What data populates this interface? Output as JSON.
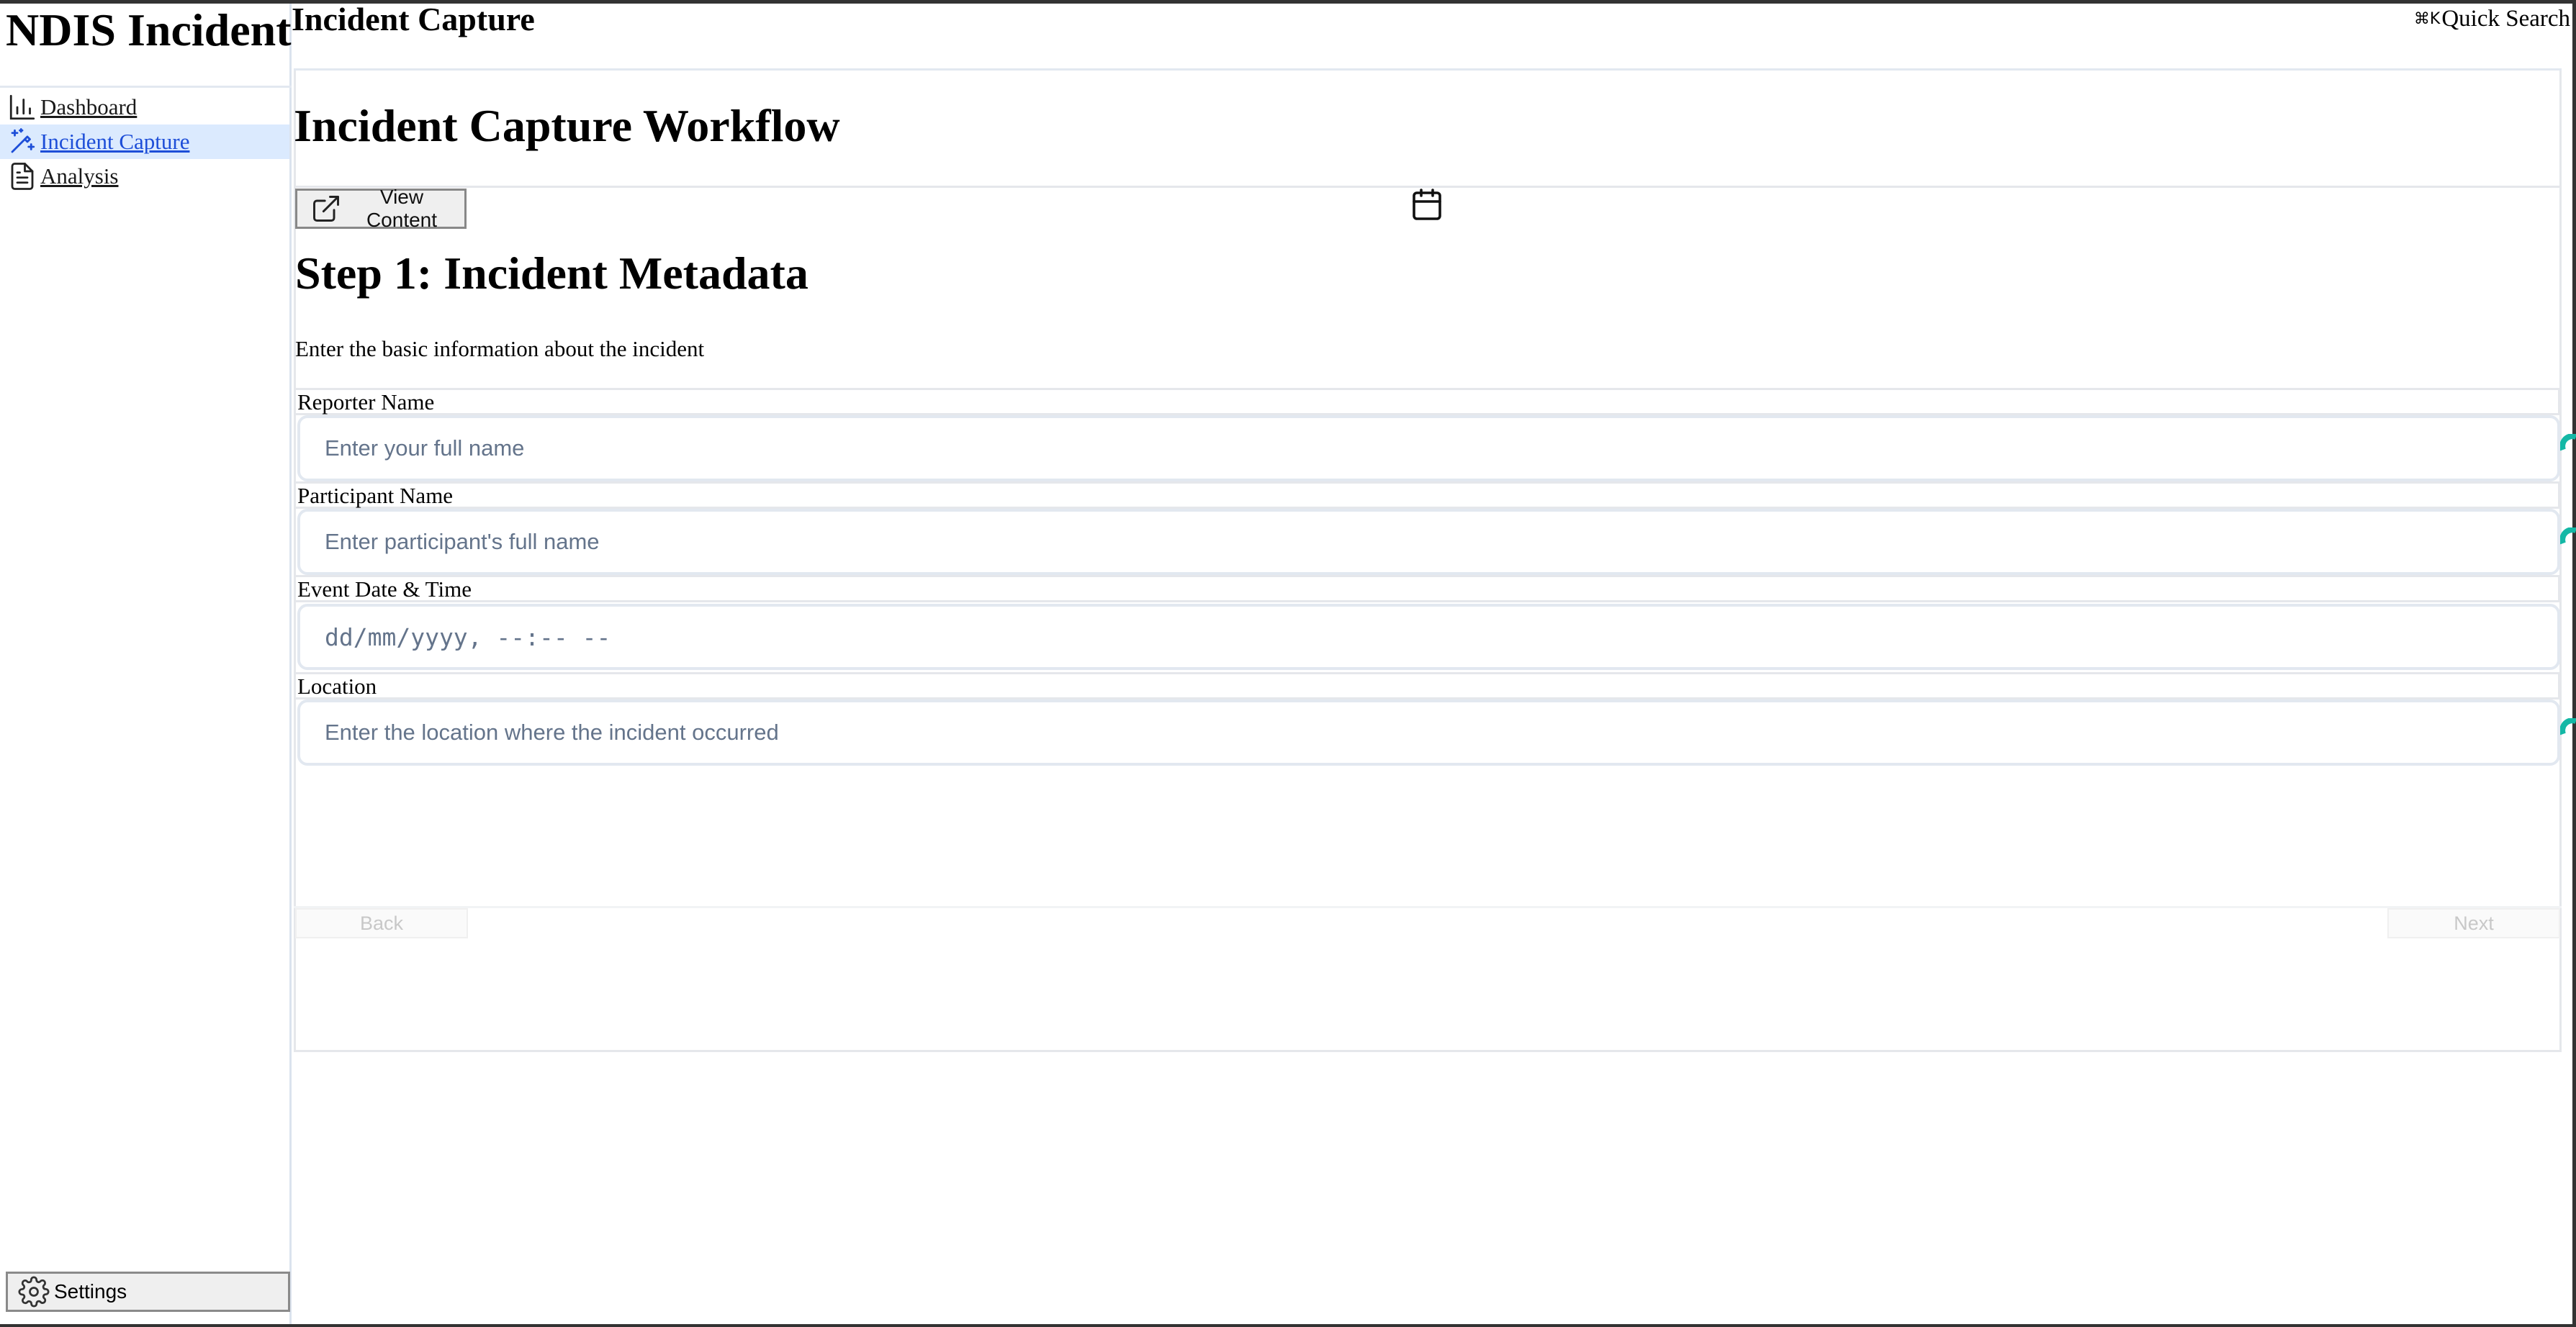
{
  "sidebar": {
    "brand": "NDIS Incident",
    "items": [
      {
        "label": "Dashboard",
        "icon": "bar-chart-icon"
      },
      {
        "label": "Incident Capture",
        "icon": "wand-sparkles-icon",
        "active": true
      },
      {
        "label": "Analysis",
        "icon": "file-text-icon"
      }
    ],
    "settings_label": "Settings",
    "active_bg": "#dbeafe",
    "active_color": "#1d4ed8"
  },
  "header": {
    "title": "Incident Capture",
    "search_shortcut": "⌘K",
    "search_label": "Quick Search"
  },
  "workflow": {
    "title": "Incident Capture Workflow",
    "view_content_label": "View Content",
    "step_title": "Step 1: Incident Metadata",
    "step_description": "Enter the basic information about the incident",
    "fields": [
      {
        "label": "Reporter Name",
        "placeholder": "Enter your full name"
      },
      {
        "label": "Participant Name",
        "placeholder": "Enter participant's full name"
      },
      {
        "label": "Event Date & Time",
        "placeholder": "dd/mm/yyyy, --:-- --"
      },
      {
        "label": "Location",
        "placeholder": "Enter the location where the incident occurred"
      }
    ],
    "back_label": "Back",
    "next_label": "Next",
    "accent": "#14b8a6"
  }
}
